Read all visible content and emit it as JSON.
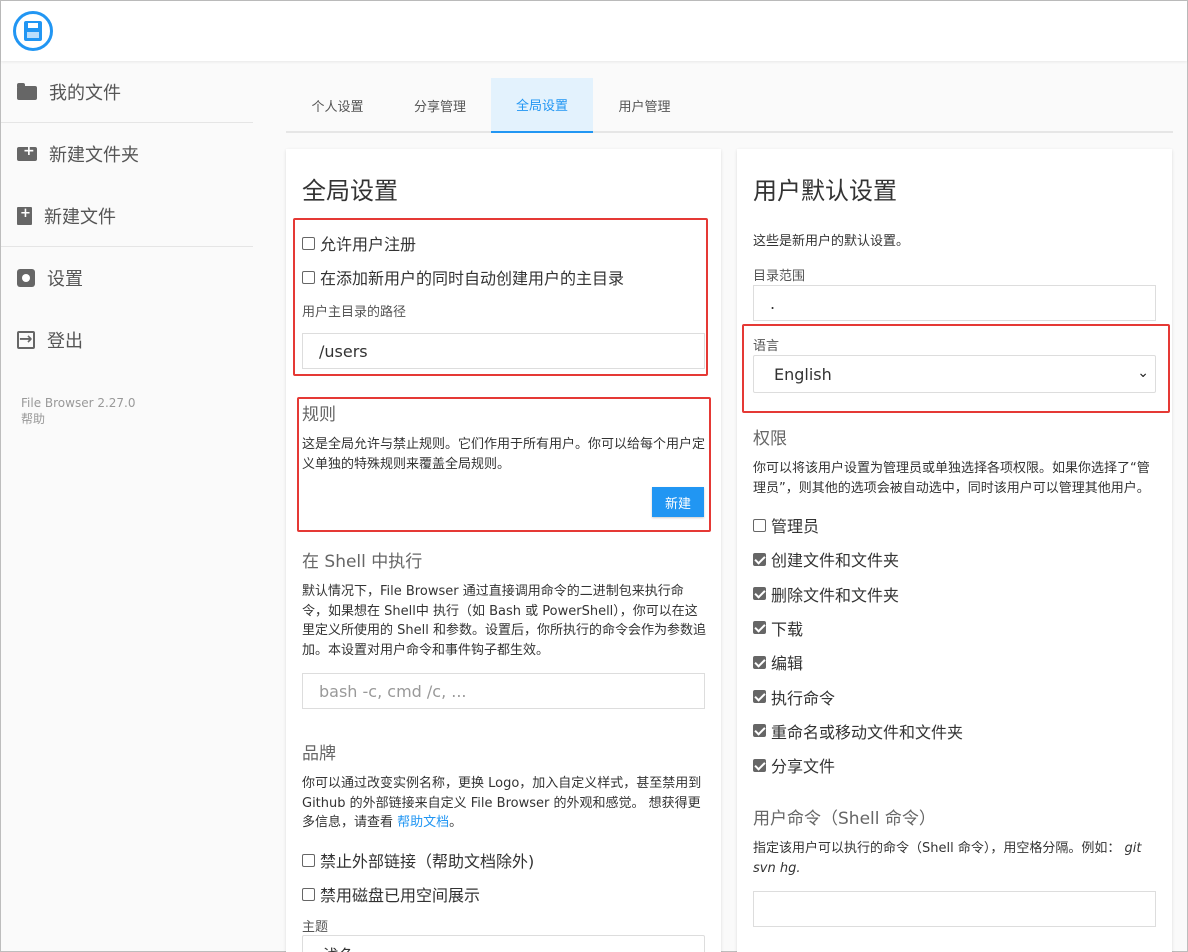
{
  "sidebar": {
    "items": [
      {
        "label": "我的文件",
        "icon": "folder-icon"
      },
      {
        "label": "新建文件夹",
        "icon": "new-folder-icon"
      },
      {
        "label": "新建文件",
        "icon": "new-file-icon"
      },
      {
        "label": "设置",
        "icon": "gear-icon"
      },
      {
        "label": "登出",
        "icon": "logout-icon"
      }
    ],
    "version": "File Browser 2.27.0",
    "help": "帮助"
  },
  "tabs": [
    {
      "label": "个人设置",
      "active": false
    },
    {
      "label": "分享管理",
      "active": false
    },
    {
      "label": "全局设置",
      "active": true
    },
    {
      "label": "用户管理",
      "active": false
    }
  ],
  "global": {
    "title": "全局设置",
    "allow_signup": {
      "label": "允许用户注册",
      "checked": false
    },
    "create_home": {
      "label": "在添加新用户的同时自动创建用户的主目录",
      "checked": false
    },
    "home_path_label": "用户主目录的路径",
    "home_path_value": "/users",
    "rules": {
      "title": "规则",
      "desc": "这是全局允许与禁止规则。它们作用于所有用户。你可以给每个用户定义单独的特殊规则来覆盖全局规则。",
      "new_button": "新建"
    },
    "shell": {
      "title": "在 Shell 中执行",
      "desc": "默认情况下，File Browser 通过直接调用命令的二进制包来执行命令，如果想在 Shell中 执行（如 Bash 或 PowerShell），你可以在这里定义所使用的 Shell 和参数。设置后，你所执行的命令会作为参数追加。本设置对用户命令和事件钩子都生效。",
      "placeholder": "bash -c, cmd /c, ..."
    },
    "branding": {
      "title": "品牌",
      "desc": "你可以通过改变实例名称，更换 Logo，加入自定义样式，甚至禁用到 Github 的外部链接来自定义 File Browser 的外观和感觉。 想获得更多信息，请查看 ",
      "link": "帮助文档",
      "desc_end": "。",
      "disable_external": {
        "label": "禁止外部链接（帮助文档除外)",
        "checked": false
      },
      "disable_disk": {
        "label": "禁用磁盘已用空间展示",
        "checked": false
      },
      "theme_label": "主题",
      "theme_value": "浅色"
    }
  },
  "defaults": {
    "title": "用户默认设置",
    "desc": "这些是新用户的默认设置。",
    "scope_label": "目录范围",
    "scope_value": ".",
    "language_label": "语言",
    "language_value": "English",
    "permissions": {
      "title": "权限",
      "desc": "你可以将该用户设置为管理员或单独选择各项权限。如果你选择了“管理员”，则其他的选项会被自动选中，同时该用户可以管理其他用户。",
      "items": [
        {
          "label": "管理员",
          "checked": false
        },
        {
          "label": "创建文件和文件夹",
          "checked": true
        },
        {
          "label": "删除文件和文件夹",
          "checked": true
        },
        {
          "label": "下载",
          "checked": true
        },
        {
          "label": "编辑",
          "checked": true
        },
        {
          "label": "执行命令",
          "checked": true
        },
        {
          "label": "重命名或移动文件和文件夹",
          "checked": true
        },
        {
          "label": "分享文件",
          "checked": true
        }
      ]
    },
    "commands": {
      "title": "用户命令（Shell 命令）",
      "desc": "指定该用户可以执行的命令（Shell 命令），用空格分隔。例如：",
      "example": " git svn hg.",
      "value": ""
    }
  },
  "colors": {
    "accent": "#2196f3",
    "highlight": "#e53935"
  }
}
